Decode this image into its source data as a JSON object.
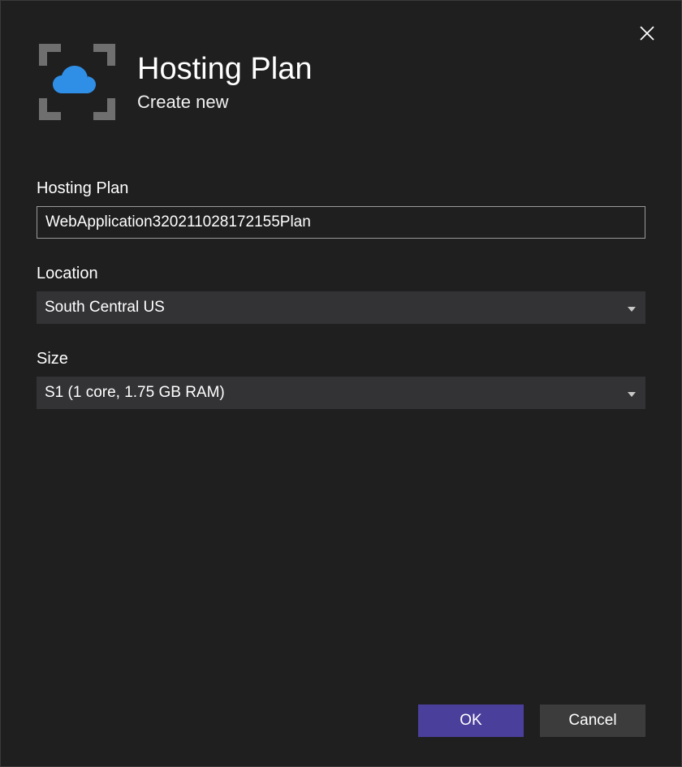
{
  "header": {
    "title": "Hosting Plan",
    "subtitle": "Create new"
  },
  "fields": {
    "hosting_plan": {
      "label": "Hosting Plan",
      "value": "WebApplication320211028172155Plan"
    },
    "location": {
      "label": "Location",
      "selected": "South Central US"
    },
    "size": {
      "label": "Size",
      "selected": "S1 (1 core, 1.75 GB RAM)"
    }
  },
  "buttons": {
    "ok": "OK",
    "cancel": "Cancel"
  },
  "colors": {
    "accent": "#4a3f9b",
    "cloud": "#2f8fe6"
  }
}
